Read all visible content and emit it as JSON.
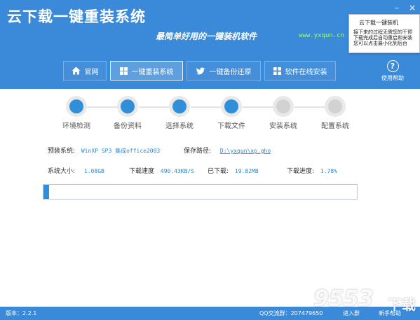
{
  "app": {
    "title": "云下载一键重装系统",
    "slogan": "最简单好用的一键装机软件",
    "site": "www.yxqun.cn"
  },
  "window": {
    "minimize": "–",
    "close": "×"
  },
  "popup": {
    "title": "云下载一键装机",
    "lines": [
      "接下来的过程无需您的干预",
      "下载完成后自动重启和安装",
      "您可以点击最小化到后台"
    ]
  },
  "help": {
    "label": "使用帮助",
    "icon": "question-circle-icon"
  },
  "nav": {
    "tabs": [
      {
        "label": "官网",
        "icon": "home-icon"
      },
      {
        "label": "一键重装系统",
        "icon": "windows-icon"
      },
      {
        "label": "一键备份还原",
        "icon": "bird-icon"
      },
      {
        "label": "软件在线安装",
        "icon": "grid-icon"
      }
    ],
    "active_index": 1
  },
  "steps": [
    {
      "label": "环境检测",
      "done": true
    },
    {
      "label": "备份资料",
      "done": true
    },
    {
      "label": "选择系统",
      "done": true
    },
    {
      "label": "下载文件",
      "done": true
    },
    {
      "label": "安装系统",
      "done": false
    },
    {
      "label": "配置系统",
      "done": false
    }
  ],
  "info": {
    "preinstall_label": "预装系统:",
    "preinstall_value": "WinXP SP3 集成office2003",
    "save_path_label": "保存路径:",
    "save_path_value": "D:\\yxqun\\xp.gho",
    "size_label": "系统大小:",
    "size_value": "1.08GB",
    "speed_label": "下载速度",
    "speed_value": "490.43KB/S",
    "downloaded_label": "已下载:",
    "downloaded_value": "19.82MB",
    "progress_label": "下载进度:",
    "progress_value": "1.78%"
  },
  "progress": {
    "percent": 1.78
  },
  "footer": {
    "version": "版本：2.2.1",
    "qq_group": "QQ交流群：207479650",
    "link1": "进入群",
    "link2": "新手帮助"
  },
  "watermark": {
    "number": "9553",
    "text": "下载"
  },
  "colors": {
    "header_bg": "#3b8ad9",
    "step_done": "#2f8fd8",
    "step_pending": "#d2d2d2",
    "value_text": "#2a8ad6"
  }
}
